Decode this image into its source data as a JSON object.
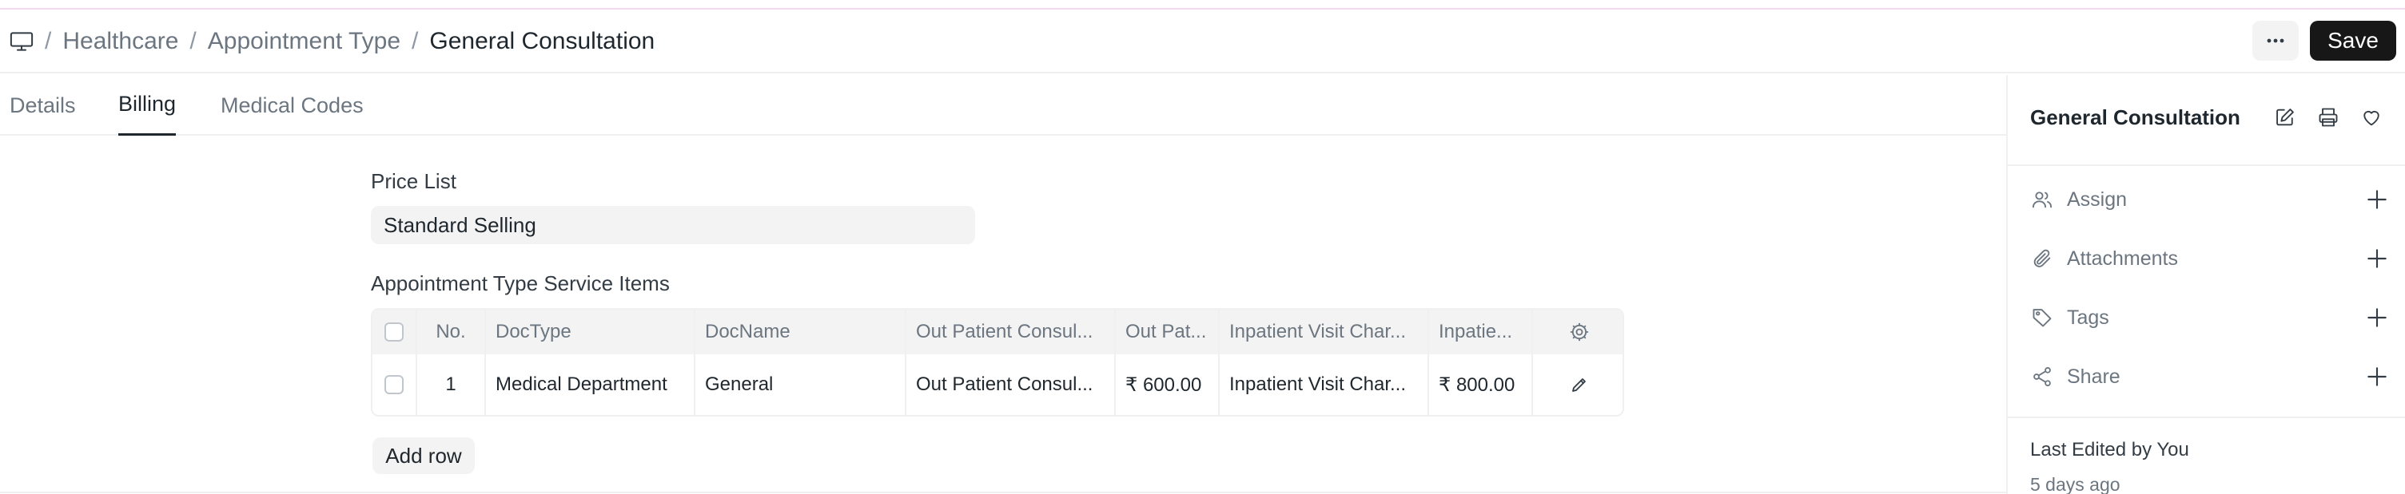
{
  "breadcrumb": {
    "icon": "monitor-icon",
    "items": [
      "Healthcare",
      "Appointment Type"
    ],
    "current": "General Consultation"
  },
  "header": {
    "more_icon": "more-horizontal-icon",
    "save_label": "Save"
  },
  "tabs": [
    {
      "label": "Details",
      "active": false
    },
    {
      "label": "Billing",
      "active": true
    },
    {
      "label": "Medical Codes",
      "active": false
    }
  ],
  "form": {
    "price_list_label": "Price List",
    "price_list_value": "Standard Selling",
    "service_items_label": "Appointment Type Service Items",
    "columns": [
      "No.",
      "DocType",
      "DocName",
      "Out Patient Consul...",
      "Out Pat...",
      "Inpatient Visit Char...",
      "Inpatie..."
    ],
    "rows": [
      [
        "1",
        "Medical Department",
        "General",
        "Out Patient Consul...",
        "₹ 600.00",
        "Inpatient Visit Char...",
        "₹ 800.00"
      ]
    ],
    "add_row_label": "Add row"
  },
  "sidebar": {
    "title": "General Consultation",
    "items": [
      {
        "label": "Assign",
        "icon": "users-icon"
      },
      {
        "label": "Attachments",
        "icon": "paperclip-icon"
      },
      {
        "label": "Tags",
        "icon": "tag-icon"
      },
      {
        "label": "Share",
        "icon": "share-icon"
      }
    ],
    "last_edited": "Last Edited by You",
    "time_ago": "5 days ago"
  },
  "colors": {
    "accent": "#171717",
    "muted_text": "#6c7680",
    "field_bg": "#f3f3f3",
    "border": "#eef0f2"
  }
}
